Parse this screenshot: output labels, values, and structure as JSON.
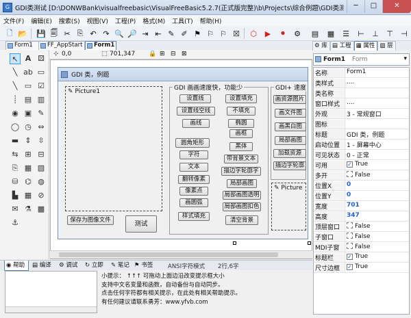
{
  "window": {
    "title": "GDI类测试 [D:\\DONWBank\\visualfreebasic\\VisualFreeBasic5.2.7(正式版完整)\\b\\Projects\\综合例题\\GDI类测试\\GDI类..."
  },
  "menu": [
    "文件(F)",
    "编辑(E)",
    "搜索(S)",
    "视图(V)",
    "工程(P)",
    "格式(M)",
    "工具(T)",
    "帮助(H)"
  ],
  "doc_tabs": [
    "Form1",
    "FF_AppStart",
    "Form1"
  ],
  "coords": {
    "pos": "0,0",
    "size": "701,347"
  },
  "right_tabs": [
    "库",
    "工程",
    "属性",
    "层"
  ],
  "form": {
    "caption": "GDI 类，例题",
    "picture1_label": "Picture1",
    "picture2_label": "Picture",
    "group1_title": "GDI 画画速度快，功能少",
    "group2_title": "GDI+ 速度",
    "btn_save": "保存为图像文件",
    "btn_test": "测试",
    "col1": [
      "设置线",
      "设置线空线",
      "画线",
      "圆角矩形",
      "字符",
      "文本",
      "翻转像素",
      "像素点",
      "画圆弧",
      "样式填充"
    ],
    "col2": [
      "设置填充",
      "不填充",
      "椭圆",
      "画框",
      "黑体",
      "带背景文本",
      "描边字轮廓字",
      "局部画图",
      "局部画图透明",
      "局部画图扣色",
      "清空背景"
    ],
    "col3": [
      "画资源图片",
      "画文件图",
      "画黑白图",
      "局部画图",
      "加载资源",
      "描边字轮廓"
    ]
  },
  "object_selector": {
    "name": "Form1",
    "type": "Form"
  },
  "properties": [
    {
      "name": "名称",
      "value": "Form1"
    },
    {
      "name": "类样式",
      "value": "...."
    },
    {
      "name": "类名称",
      "value": ""
    },
    {
      "name": "窗口样式",
      "value": "...."
    },
    {
      "name": "外观",
      "value": "3 - 常规窗口"
    },
    {
      "name": "图标",
      "value": ""
    },
    {
      "name": "标题",
      "value": "GDI 类，例题"
    },
    {
      "name": "启动位置",
      "value": "1 - 屏幕中心"
    },
    {
      "name": "可见状态",
      "value": "0 - 正常"
    },
    {
      "name": "可用",
      "value": "True",
      "check": true
    },
    {
      "name": "多开",
      "value": "False",
      "check": false
    },
    {
      "name": "位置X",
      "value": "0",
      "num": true
    },
    {
      "name": "位置Y",
      "value": "0",
      "num": true
    },
    {
      "name": "宽度",
      "value": "701",
      "num": true
    },
    {
      "name": "高度",
      "value": "347",
      "num": true
    },
    {
      "name": "顶层窗口",
      "value": "False",
      "check": false
    },
    {
      "name": "子窗口",
      "value": "False",
      "check": false
    },
    {
      "name": "MDI子窗",
      "value": "False",
      "check": false
    },
    {
      "name": "标题栏",
      "value": "True",
      "check": true
    },
    {
      "name": "尺寸边框",
      "value": "True",
      "check": true
    }
  ],
  "bottom_tabs": [
    "帮助",
    "编译",
    "调试",
    "立即",
    "笔记",
    "书签"
  ],
  "status": {
    "mode": "ANSI字符模式",
    "position": "2行,6字"
  },
  "tips": [
    "小提示： ↑↑↑ 可拖动上面边沿改变提示框大小",
    "支持中文名变量和函数，自动备份与自动同步。",
    "点击任何字符都有相关提示，在此处有相关帮助提示。",
    "有任何建议请联系勇芳：www.yfvb.com"
  ],
  "colors": {
    "accent": "#2a62c9",
    "close": "#c75050"
  }
}
